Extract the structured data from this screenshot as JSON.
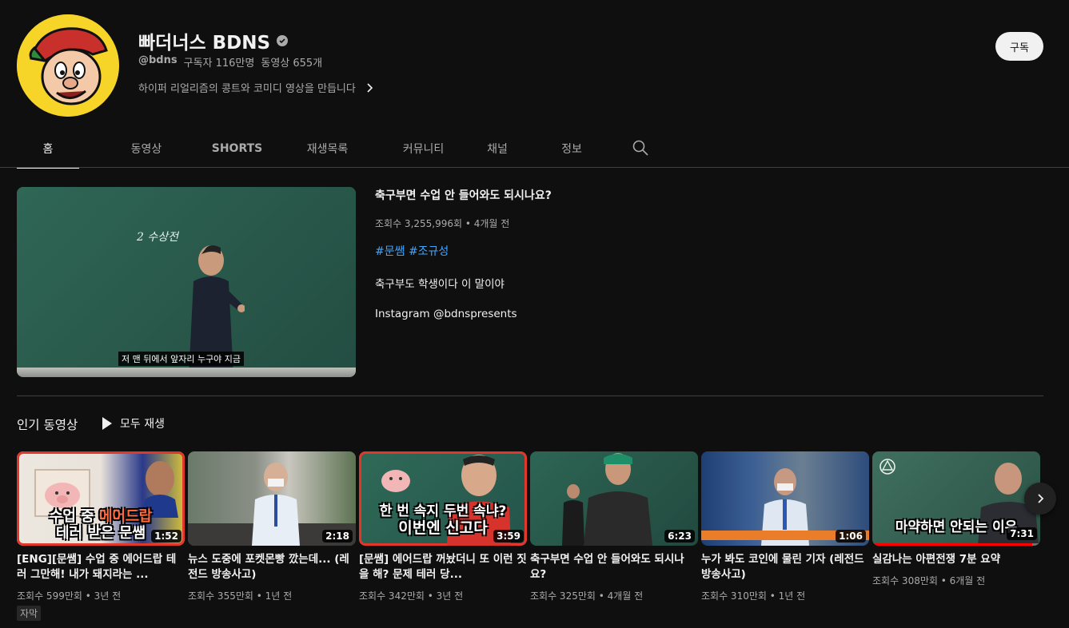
{
  "channel": {
    "name": "빠더너스 BDNS",
    "handle": "@bdns",
    "subscribers": "구독자 116만명",
    "videos": "동영상 655개",
    "description": "하이퍼 리얼리즘의 콩트와 코미디 영상을 만듭니다",
    "subscribe_label": "구독"
  },
  "tabs": [
    {
      "label": "홈",
      "active": true
    },
    {
      "label": "동영상"
    },
    {
      "label": "SHORTS"
    },
    {
      "label": "재생목록"
    },
    {
      "label": "커뮤니티"
    },
    {
      "label": "채널"
    },
    {
      "label": "정보"
    }
  ],
  "featured": {
    "title": "축구부면 수업 안 들어와도 되시나요?",
    "meta": "조회수 3,255,996회 • 4개월 전",
    "tags": "#문쌤 #조규성",
    "desc1": "축구부도 학생이다 이 말이야",
    "desc2": "Instagram @bdnspresents",
    "thumb_subtitle": "저 맨 뒤에서 앞자리 누구야 지금",
    "board_text": "2 수상전"
  },
  "popular": {
    "title": "인기 동영상",
    "play_all": "모두 재생",
    "videos": [
      {
        "title": "[ENG][문쌤] 수업 중 에어드랍 테러 그만해! 내가 돼지라는 ...",
        "meta": "조회수 599만회 • 3년 전",
        "duration": "1:52",
        "badge": "자막",
        "overlay1": "수업 중 ",
        "overlay_hl": "에어드랍",
        "overlay2": "테러 받은 문쌤"
      },
      {
        "title": "뉴스 도중에 포켓몬빵 깠는데... (레전드 방송사고)",
        "meta": "조회수 355만회 • 1년 전",
        "duration": "2:18"
      },
      {
        "title": "[문쌤] 에어드랍 꺼놨더니 또 이런 짓을 해? 문제 테러 당...",
        "meta": "조회수 342만회 • 3년 전",
        "duration": "3:59",
        "overlay1": "한 번 속지 두번 속냐?",
        "overlay2": "이번엔 신고다"
      },
      {
        "title": "축구부면 수업 안 들어와도 되시나요?",
        "meta": "조회수 325만회 • 4개월 전",
        "duration": "6:23"
      },
      {
        "title": "누가 봐도 코인에 물린 기자 (레전드 방송사고)",
        "meta": "조회수 310만회 • 1년 전",
        "duration": "1:06"
      },
      {
        "title": "실감나는 아편전쟁 7분 요약",
        "meta": "조회수 308만회 • 6개월 전",
        "duration": "7:31",
        "overlay1": "마약하면 안되는 이유",
        "progress": 0.95
      }
    ]
  }
}
